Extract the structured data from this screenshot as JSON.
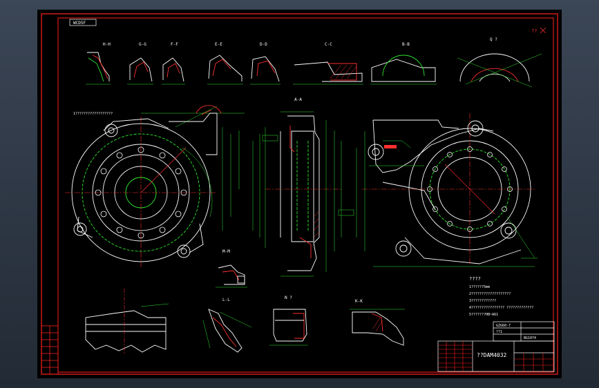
{
  "sheet": {
    "tag": "WCDSF",
    "note_mark": "??",
    "section_titles": [
      "H-H",
      "G-G",
      "F-F",
      "E-E",
      "D-D",
      "C-C",
      "B-B",
      "Q ?",
      "A-A",
      "M-M",
      "L-L",
      "N ?",
      "K-K"
    ],
    "leader_text": "1??????????????????",
    "tech_req_title": "????",
    "tech_req_lines": [
      "1??????5mm",
      "2???????????????????",
      "3????????????",
      "4???????????????? ?????????????",
      "5???????HB~A61"
    ],
    "title_block": {
      "material": "GZG60-7",
      "scale": "??1",
      "part_code": "BG1074",
      "drawing_name": "??DAM4032"
    }
  }
}
